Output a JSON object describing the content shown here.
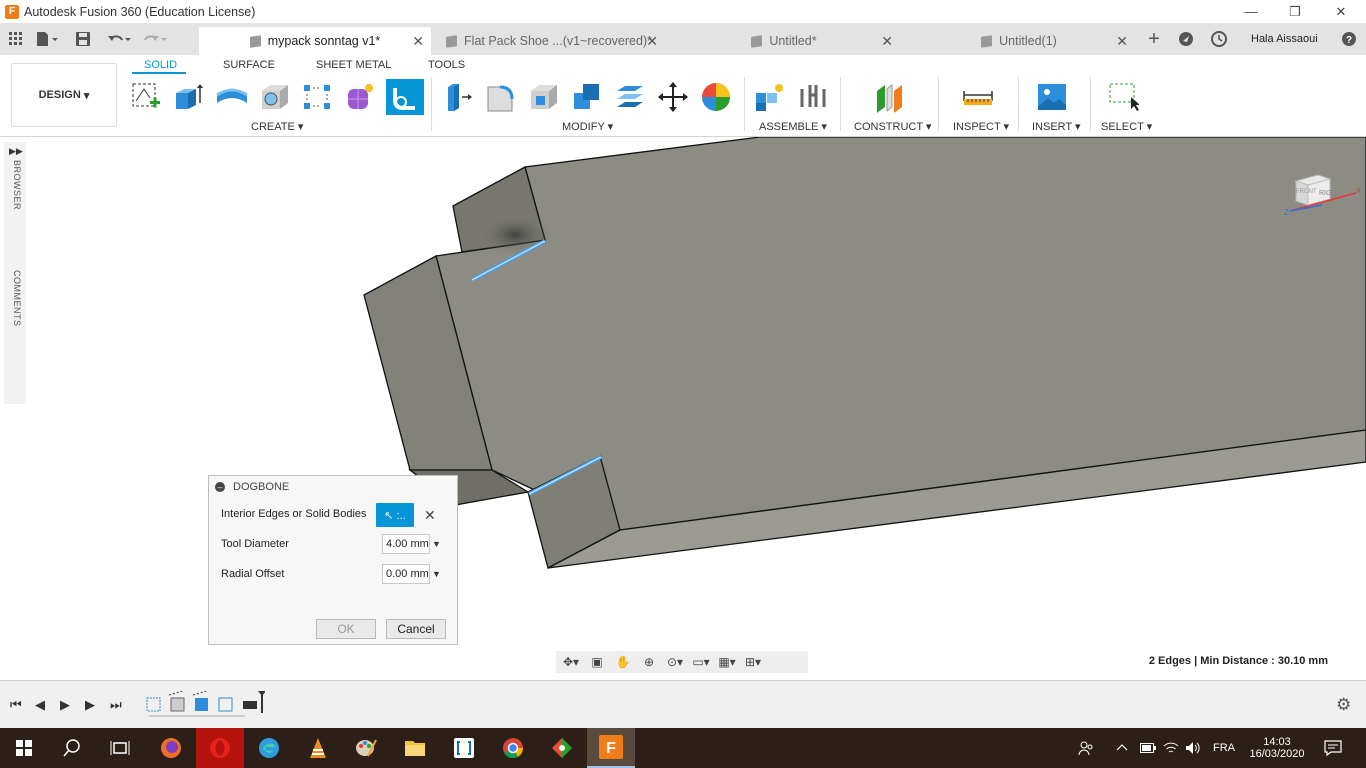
{
  "window": {
    "title": "Autodesk Fusion 360 (Education License)",
    "min": "—",
    "restore": "❐",
    "close": "✕"
  },
  "tabs": [
    {
      "label": "mypack sonntag v1*",
      "active": true
    },
    {
      "label": "Flat Pack Shoe ...(v1~recovered)*",
      "active": false
    },
    {
      "label": "Untitled*",
      "active": false
    },
    {
      "label": "Untitled(1)",
      "active": false
    }
  ],
  "user": {
    "name": "Hala Aissaoui"
  },
  "ribbon": {
    "workspace": "DESIGN",
    "tabs": [
      "SOLID",
      "SURFACE",
      "SHEET METAL",
      "TOOLS"
    ],
    "groups": [
      "CREATE",
      "MODIFY",
      "ASSEMBLE",
      "CONSTRUCT",
      "INSPECT",
      "INSERT",
      "SELECT"
    ]
  },
  "side_panels": {
    "browser": "BROWSER",
    "comments": "COMMENTS"
  },
  "dialog": {
    "title": "DOGBONE",
    "edges_label": "Interior Edges or Solid Bodies",
    "select_label": "↖ :..",
    "tool_diameter_label": "Tool Diameter",
    "tool_diameter_value": "4.00 mm",
    "radial_offset_label": "Radial Offset",
    "radial_offset_value": "0.00 mm",
    "ok": "OK",
    "cancel": "Cancel"
  },
  "viewcube": {
    "face": "RIGHT",
    "left_face": "FRONT",
    "axis_z": "Z",
    "axis_x": "X"
  },
  "status": {
    "text": "2 Edges | Min Distance : 30.10 mm"
  },
  "taskbar": {
    "lang": "FRA",
    "time": "14:03",
    "date": "16/03/2020"
  },
  "colors": {
    "accent": "#0696d7",
    "model_face": "#8c8b84",
    "taskbar": "#2b1f17",
    "fusion_orange": "#f07d1a"
  }
}
